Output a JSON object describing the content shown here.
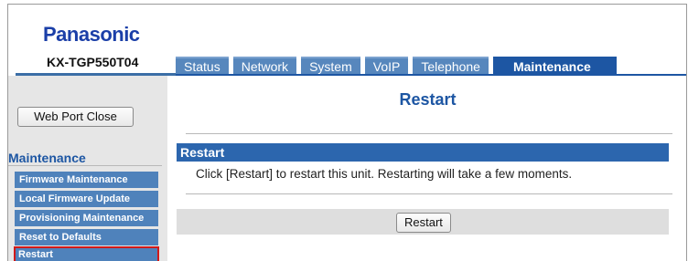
{
  "header": {
    "brand": "Panasonic",
    "model": "KX-TGP550T04"
  },
  "tabs": [
    {
      "label": "Status",
      "active": false
    },
    {
      "label": "Network",
      "active": false
    },
    {
      "label": "System",
      "active": false
    },
    {
      "label": "VoIP",
      "active": false
    },
    {
      "label": "Telephone",
      "active": false
    },
    {
      "label": "Maintenance",
      "active": true
    }
  ],
  "sidebar": {
    "web_port_close_label": "Web Port Close",
    "heading": "Maintenance",
    "items": [
      {
        "label": "Firmware Maintenance",
        "active": false
      },
      {
        "label": "Local Firmware Update",
        "active": false
      },
      {
        "label": "Provisioning Maintenance",
        "active": false
      },
      {
        "label": "Reset to Defaults",
        "active": false
      },
      {
        "label": "Restart",
        "active": true
      }
    ]
  },
  "main": {
    "title": "Restart",
    "section_heading": "Restart",
    "description": "Click [Restart] to restart this unit. Restarting will take a few moments.",
    "restart_button_label": "Restart"
  },
  "colors": {
    "brand_blue": "#1b3fa8",
    "tab_blue": "#5787bd",
    "active_tab_blue": "#1d56a3",
    "section_bar_blue": "#2c66ae",
    "highlight_red": "#d11a1a"
  }
}
